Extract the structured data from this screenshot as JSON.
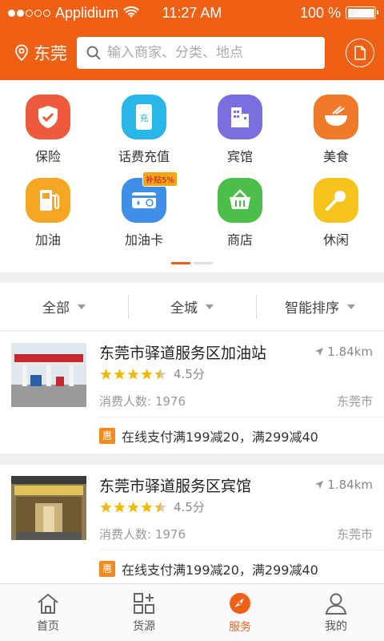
{
  "status_bar": {
    "carrier": "Applidium",
    "time": "11:27 AM",
    "battery": "100 %",
    "battery_level": 1.0
  },
  "header": {
    "city": "东莞",
    "search_placeholder": "输入商家、分类、地点"
  },
  "categories": [
    {
      "label": "保险",
      "icon": "shield-check-icon",
      "color": "#f05a3c"
    },
    {
      "label": "话费充值",
      "icon": "phone-recharge-icon",
      "color": "#29b6e8"
    },
    {
      "label": "宾馆",
      "icon": "hotel-building-icon",
      "color": "#7b6fe0"
    },
    {
      "label": "美食",
      "icon": "food-bowl-icon",
      "color": "#f07a2a"
    },
    {
      "label": "加油",
      "icon": "fuel-pump-icon",
      "color": "#f5a623"
    },
    {
      "label": "加油卡",
      "icon": "fuel-card-icon",
      "color": "#3f8fe8",
      "badge": "补贴5%"
    },
    {
      "label": "商店",
      "icon": "shop-basket-icon",
      "color": "#4cbf4a"
    },
    {
      "label": "休闲",
      "icon": "microphone-icon",
      "color": "#f7c21c"
    }
  ],
  "filters": [
    {
      "label": "全部"
    },
    {
      "label": "全城"
    },
    {
      "label": "智能排序"
    }
  ],
  "listings": [
    {
      "name": "东莞市驿道服务区加油站",
      "distance": "1.84km",
      "rating": 4.5,
      "rating_text": "4.5分",
      "consumers": "消费人数: 1976",
      "area": "东莞市",
      "promo_badge": "惠",
      "promo": "在线支付满199减20，满299减40"
    },
    {
      "name": "东莞市驿道服务区宾馆",
      "distance": "1.84km",
      "rating": 4.5,
      "rating_text": "4.5分",
      "consumers": "消费人数: 1976",
      "area": "东莞市",
      "promo_badge": "惠",
      "promo": "在线支付满199减20，满299减40"
    }
  ],
  "tabs": [
    {
      "label": "首页",
      "icon": "home-icon"
    },
    {
      "label": "货源",
      "icon": "grid-plus-icon"
    },
    {
      "label": "服务",
      "icon": "compass-icon",
      "active": true
    },
    {
      "label": "我的",
      "icon": "user-icon"
    }
  ],
  "colors": {
    "brand": "#f06014",
    "star": "#f5b800",
    "promo_badge": "#f28a1e"
  }
}
